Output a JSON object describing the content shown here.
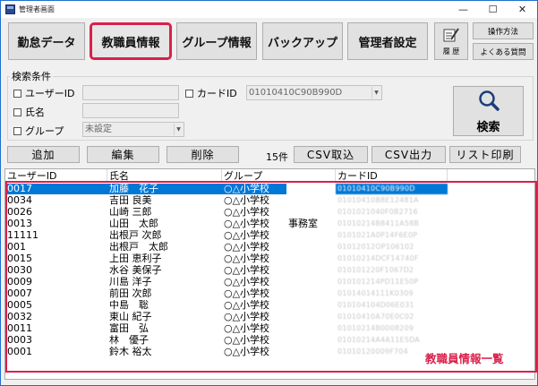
{
  "window": {
    "title": "管理者画面",
    "controls": [
      "—",
      "☐",
      "✕"
    ]
  },
  "toolbar": {
    "attendance": "勤怠データ",
    "staff": "教職員情報",
    "group": "グループ情報",
    "backup": "バックアップ",
    "admin": "管理者設定",
    "history": "履 歴",
    "manual": "操作方法",
    "faq": "よくある質問"
  },
  "search": {
    "group_label": "検索条件",
    "user_id_label": "ユーザーID",
    "card_id_label": "カードID",
    "card_id_value": "01010410C90B990D",
    "name_label": "氏名",
    "group_field_label": "グループ",
    "group_value": "未設定",
    "search_button": "検索"
  },
  "actions": {
    "add": "追加",
    "edit": "編集",
    "delete": "削除",
    "count": "15件",
    "csv_import": "CSV取込",
    "csv_export": "CSV出力",
    "list_print": "リスト印刷"
  },
  "table": {
    "columns": [
      "ユーザーID",
      "氏名",
      "グループ",
      "カードID"
    ],
    "rows": [
      {
        "id": "0017",
        "name": "加藤　花子",
        "group": "○△小学校",
        "extra": "",
        "card": "01010410C90B990D"
      },
      {
        "id": "0034",
        "name": "吉田 良美",
        "group": "○△小学校",
        "extra": "",
        "card": "01010410B8E12481A"
      },
      {
        "id": "0026",
        "name": "山崎 三郎",
        "group": "○△小学校",
        "extra": "",
        "card": "0101021040F0B2716"
      },
      {
        "id": "0013",
        "name": "山田　太郎",
        "group": "○△小学校",
        "extra": "事務室",
        "card": "01010214B8411A58B"
      },
      {
        "id": "11111",
        "name": "出根戸 次郎",
        "group": "○△小学校",
        "extra": "",
        "card": "0101021A0P14F6E0P"
      },
      {
        "id": "001",
        "name": "出根戸　太郎",
        "group": "○△小学校",
        "extra": "",
        "card": "01012012OP106102"
      },
      {
        "id": "0015",
        "name": "上田 恵利子",
        "group": "○△小学校",
        "extra": "",
        "card": "01010214DCF14740F"
      },
      {
        "id": "0030",
        "name": "水谷 美保子",
        "group": "○△小学校",
        "extra": "",
        "card": "010101220F1067D2"
      },
      {
        "id": "0009",
        "name": "川島 洋子",
        "group": "○△小学校",
        "extra": "",
        "card": "010101214PD11E50P"
      },
      {
        "id": "0007",
        "name": "前田 次郎",
        "group": "○△小学校",
        "extra": "",
        "card": "01014014111K0309"
      },
      {
        "id": "0005",
        "name": "中島　聡",
        "group": "○△小学校",
        "extra": "",
        "card": "010104104D06E031"
      },
      {
        "id": "0032",
        "name": "東山 紀子",
        "group": "○△小学校",
        "extra": "",
        "card": "01010410A70E0C02"
      },
      {
        "id": "0011",
        "name": "富田　弘",
        "group": "○△小学校",
        "extra": "",
        "card": "01010214B0008209"
      },
      {
        "id": "0003",
        "name": "林　優子",
        "group": "○△小学校",
        "extra": "",
        "card": "01010214A4A11E5DA"
      },
      {
        "id": "0001",
        "name": "鈴木 裕太",
        "group": "○△小学校",
        "extra": "",
        "card": "01010120009F704"
      }
    ]
  },
  "annotation": {
    "caption": "教職員情報一覧"
  },
  "colors": {
    "accent": "#d9204a",
    "selection": "#0078d7"
  }
}
